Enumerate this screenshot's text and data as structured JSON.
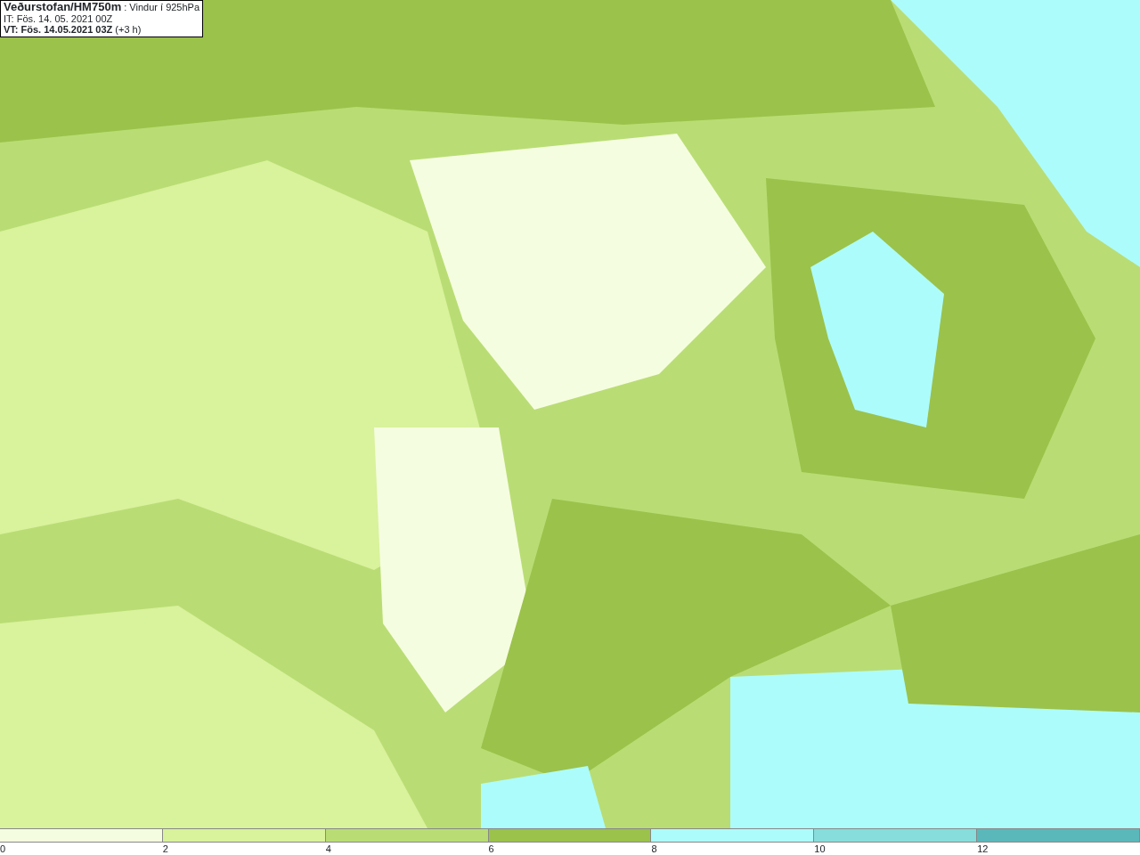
{
  "info_box": {
    "lines": [
      "**Veðurstofan/HM750m** : Vindur í 925hPa",
      "IT: Fös. 14. 05. 2021 00Z",
      "**VT: Fös. 14.05.2021 03Z** (+3 h)"
    ]
  },
  "legend": {
    "bins": [
      {
        "label": "0",
        "color": "#f5fde0"
      },
      {
        "label": "2",
        "color": "#d9f29c"
      },
      {
        "label": "4",
        "color": "#b9dd74"
      },
      {
        "label": "6",
        "color": "#9bc24a"
      },
      {
        "label": "8",
        "color": "#adfcfc"
      },
      {
        "label": "10",
        "color": "#86dddb"
      },
      {
        "label": "12",
        "color": "#5ab8ba"
      }
    ]
  }
}
